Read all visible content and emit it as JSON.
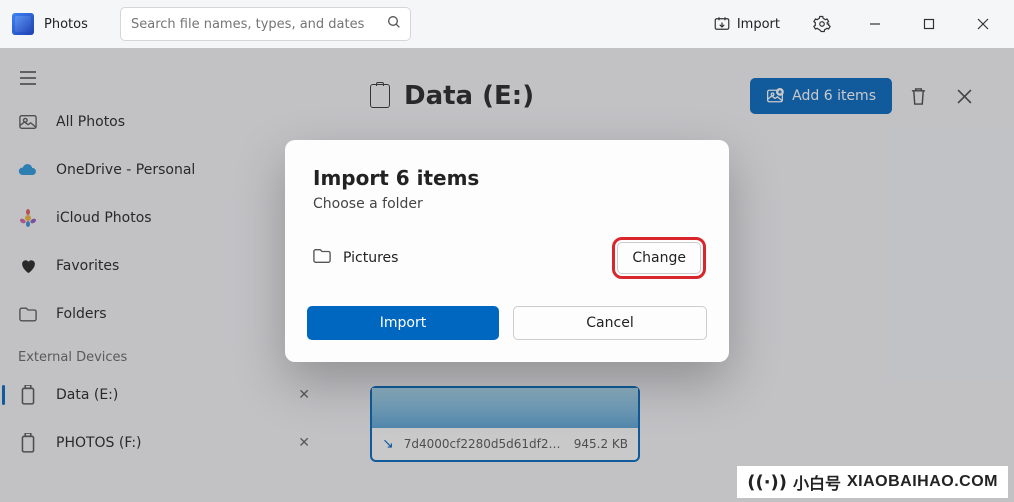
{
  "app": {
    "title": "Photos"
  },
  "search": {
    "placeholder": "Search file names, types, and dates"
  },
  "toolbar": {
    "import": "Import"
  },
  "sidebar": {
    "all_photos": "All Photos",
    "onedrive": "OneDrive - Personal",
    "icloud": "iCloud Photos",
    "favorites": "Favorites",
    "folders": "Folders",
    "external_header": "External Devices",
    "dev1": "Data (E:)",
    "dev2": "PHOTOS (F:)",
    "remove": "✕"
  },
  "main": {
    "title": "Data (E:)",
    "add_btn": "Add 6 items"
  },
  "card": {
    "name": "7d4000cf2280d5d61df26c6ab558...",
    "size": "945.2 KB"
  },
  "dialog": {
    "title": "Import 6 items",
    "subtitle": "Choose a folder",
    "dest": "Pictures",
    "change": "Change",
    "import": "Import",
    "cancel": "Cancel"
  },
  "watermark": {
    "brand": "小白号",
    "url": "XIAOBAIHAO.COM"
  }
}
